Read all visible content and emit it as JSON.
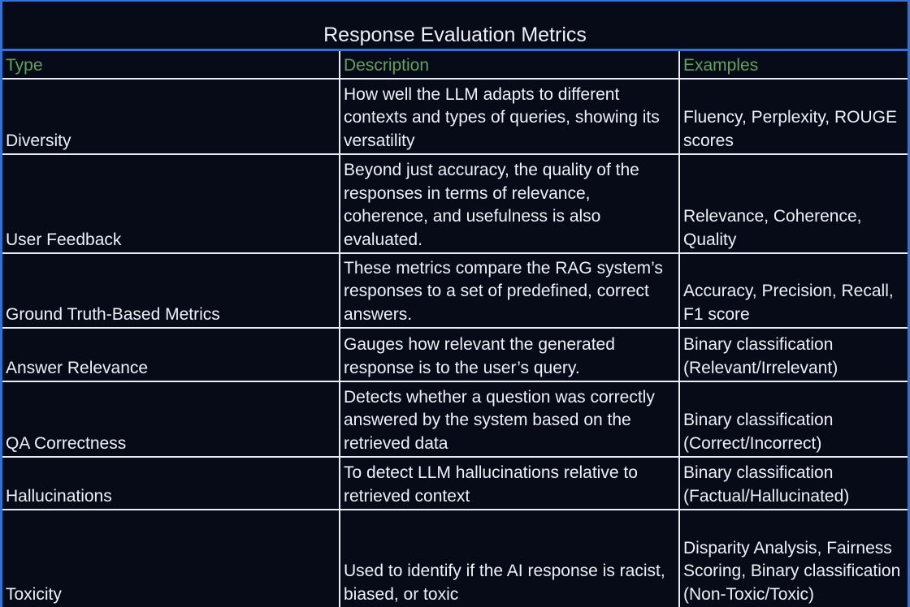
{
  "title": "Response Evaluation Metrics",
  "colors": {
    "accent_border": "#2a74dc",
    "header_text": "#5fa35c",
    "background": "#060b17",
    "text": "#eef0f8"
  },
  "columns": [
    "Type",
    "Description",
    "Examples"
  ],
  "rows": [
    {
      "type": "Diversity",
      "description": "How well the LLM adapts to different contexts and types of queries, showing its versatility",
      "examples": "Fluency, Perplexity, ROUGE scores"
    },
    {
      "type": "User Feedback",
      "description": "Beyond just accuracy, the quality of the responses in terms of relevance, coherence, and usefulness is also evaluated.",
      "examples": "Relevance, Coherence, Quality"
    },
    {
      "type": "Ground Truth-Based Metrics",
      "description": "These metrics compare the RAG system’s responses to a set of predefined, correct answers.",
      "examples": "Accuracy, Precision, Recall, F1 score"
    },
    {
      "type": "Answer Relevance",
      "description": "Gauges how relevant the generated response is to the user’s query.",
      "examples": "Binary classification (Relevant/Irrelevant)"
    },
    {
      "type": "QA Correctness",
      "description": "Detects whether a question was correctly answered by the system based on the retrieved data",
      "examples": "Binary classification (Correct/Incorrect)"
    },
    {
      "type": "Hallucinations",
      "description": "To detect LLM hallucinations relative to retrieved context",
      "examples": "Binary classification (Factual/Hallucinated)"
    },
    {
      "type": "Toxicity",
      "description": "Used to identify if the AI response is racist, biased, or toxic",
      "examples": "Disparity Analysis, Fairness Scoring, Binary classification (Non-Toxic/Toxic)"
    }
  ]
}
